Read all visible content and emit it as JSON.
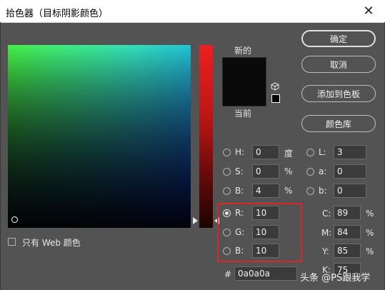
{
  "window": {
    "title": "拾色器（目标阴影颜色）"
  },
  "swatches": {
    "new_label": "新的",
    "current_label": "当前",
    "new_color": "#0a0a0a",
    "current_color": "#0a0a0a"
  },
  "buttons": {
    "ok": "确定",
    "cancel": "取消",
    "add_to_swatches": "添加到色板",
    "color_libraries": "颜色库"
  },
  "hsb": {
    "h": {
      "label": "H:",
      "value": "0",
      "unit": "度"
    },
    "s": {
      "label": "S:",
      "value": "0",
      "unit": "%"
    },
    "b": {
      "label": "B:",
      "value": "4",
      "unit": "%"
    }
  },
  "lab": {
    "l": {
      "label": "L:",
      "value": "3"
    },
    "a": {
      "label": "a:",
      "value": "0"
    },
    "b": {
      "label": "b:",
      "value": "0"
    }
  },
  "rgb": {
    "r": {
      "label": "R:",
      "value": "10"
    },
    "g": {
      "label": "G:",
      "value": "10"
    },
    "b": {
      "label": "B:",
      "value": "10"
    }
  },
  "cmyk": {
    "c": {
      "label": "C:",
      "value": "89",
      "unit": "%"
    },
    "m": {
      "label": "M:",
      "value": "84",
      "unit": "%"
    },
    "y": {
      "label": "Y:",
      "value": "85",
      "unit": "%"
    },
    "k": {
      "label": "K:",
      "value": "75"
    }
  },
  "hex": {
    "label": "#",
    "value": "0a0a0a"
  },
  "web_only": {
    "label": "只有 Web 颜色"
  },
  "selected_mode": "R",
  "watermark": "头条 @PS跟我学",
  "colors": {
    "accent_highlight": "#d8262b",
    "background": "#535353"
  },
  "icons": {
    "close": "close-icon",
    "cube": "cube-icon",
    "websafe": "websafe-swatch-icon",
    "cursor": "mouse-pointer-icon"
  }
}
